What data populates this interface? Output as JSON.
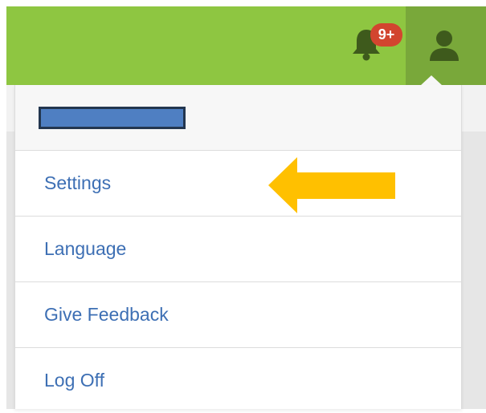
{
  "colors": {
    "header_bg": "#8ec641",
    "user_button_bg": "#79a83a",
    "icon_dark": "#3e5a1c",
    "badge_bg": "#d2452f",
    "link_text": "#3d6fb4",
    "redaction_fill": "#4f7fc2",
    "arrow": "#ffc000"
  },
  "header": {
    "notifications": {
      "icon": "bell-icon",
      "badge": "9+"
    },
    "user_button": {
      "icon": "user-icon"
    }
  },
  "menu": {
    "items": [
      {
        "label": "Settings"
      },
      {
        "label": "Language"
      },
      {
        "label": "Give Feedback"
      },
      {
        "label": "Log Off"
      }
    ]
  }
}
